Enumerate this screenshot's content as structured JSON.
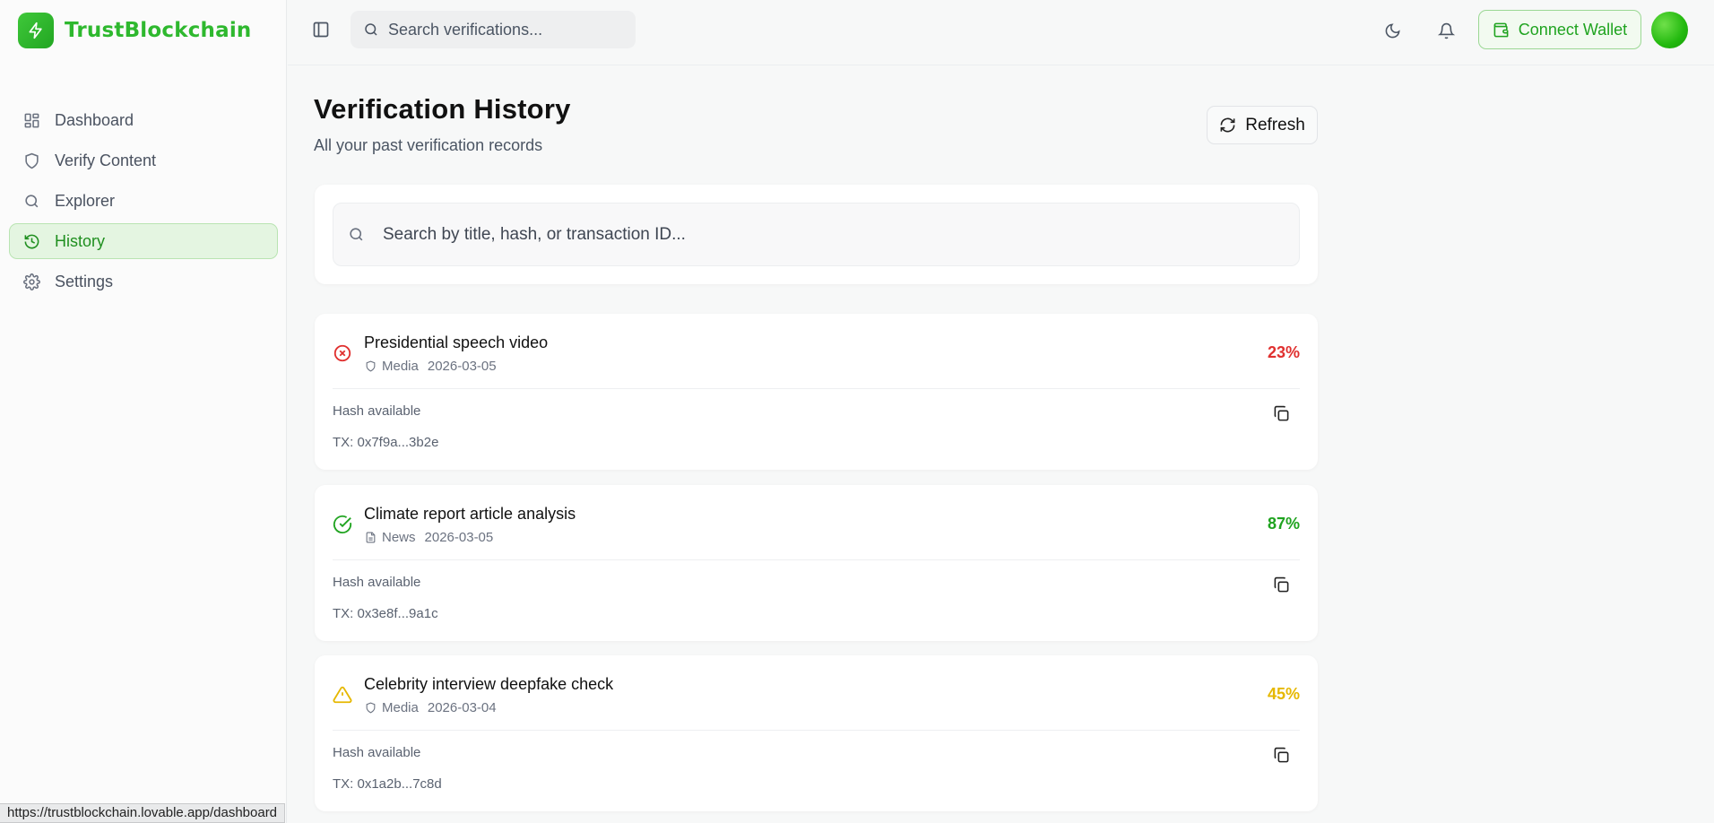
{
  "brand": {
    "name": "TrustBlockchain",
    "accent": "#2eb82e"
  },
  "sidebar": {
    "items": [
      {
        "label": "Dashboard",
        "icon": "dashboard-icon",
        "active": false
      },
      {
        "label": "Verify Content",
        "icon": "shield-icon",
        "active": false
      },
      {
        "label": "Explorer",
        "icon": "search-icon",
        "active": false
      },
      {
        "label": "History",
        "icon": "history-icon",
        "active": true
      },
      {
        "label": "Settings",
        "icon": "gear-icon",
        "active": false
      }
    ]
  },
  "header": {
    "search_placeholder": "Search verifications...",
    "connect_wallet_label": "Connect Wallet"
  },
  "main": {
    "title": "Verification History",
    "subtitle": "All your past verification records",
    "refresh_label": "Refresh",
    "filter_placeholder": "Search by title, hash, or transaction ID..."
  },
  "records": [
    {
      "title": "Presidential speech video",
      "category": "Media",
      "date": "2026-03-05",
      "score": "23%",
      "status": "failed",
      "status_color": "#e0302f",
      "hash_label": "Hash available",
      "tx": "TX: 0x7f9a...3b2e"
    },
    {
      "title": "Climate report article analysis",
      "category": "News",
      "date": "2026-03-05",
      "score": "87%",
      "status": "verified",
      "status_color": "#1fa31f",
      "hash_label": "Hash available",
      "tx": "TX: 0x3e8f...9a1c"
    },
    {
      "title": "Celebrity interview deepfake check",
      "category": "Media",
      "date": "2026-03-04",
      "score": "45%",
      "status": "warning",
      "status_color": "#e6b800",
      "hash_label": "Hash available",
      "tx": "TX: 0x1a2b...7c8d"
    }
  ],
  "status_bar": {
    "url": "https://trustblockchain.lovable.app/dashboard"
  }
}
